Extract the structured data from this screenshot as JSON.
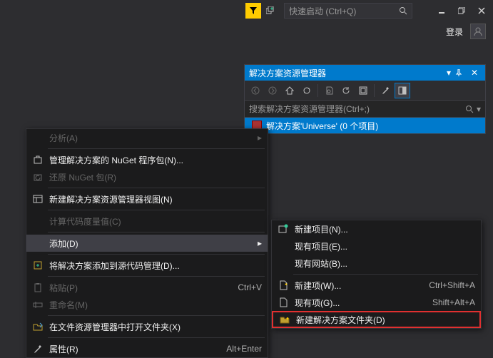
{
  "titlebar": {
    "quick_launch_placeholder": "快速启动 (Ctrl+Q)",
    "login_label": "登录"
  },
  "solution_explorer": {
    "title": "解决方案资源管理器",
    "search_placeholder": "搜索解决方案资源管理器(Ctrl+;)",
    "root_node": "解决方案'Universe' (0 个项目)"
  },
  "menu": {
    "analyze": "分析(A)",
    "manage_nuget": "管理解决方案的 NuGet 程序包(N)...",
    "restore_nuget": "还原 NuGet 包(R)",
    "new_view": "新建解决方案资源管理器视图(N)",
    "code_metrics": "计算代码度量值(C)",
    "add": "添加(D)",
    "add_source_control": "将解决方案添加到源代码管理(D)...",
    "paste": "粘贴(P)",
    "paste_shortcut": "Ctrl+V",
    "rename": "重命名(M)",
    "open_in_explorer": "在文件资源管理器中打开文件夹(X)",
    "properties": "属性(R)",
    "properties_shortcut": "Alt+Enter"
  },
  "submenu": {
    "new_project": "新建项目(N)...",
    "existing_project": "现有项目(E)...",
    "existing_website": "现有网站(B)...",
    "new_item": "新建项(W)...",
    "new_item_shortcut": "Ctrl+Shift+A",
    "existing_item": "现有项(G)...",
    "existing_item_shortcut": "Shift+Alt+A",
    "new_solution_folder": "新建解决方案文件夹(D)"
  }
}
